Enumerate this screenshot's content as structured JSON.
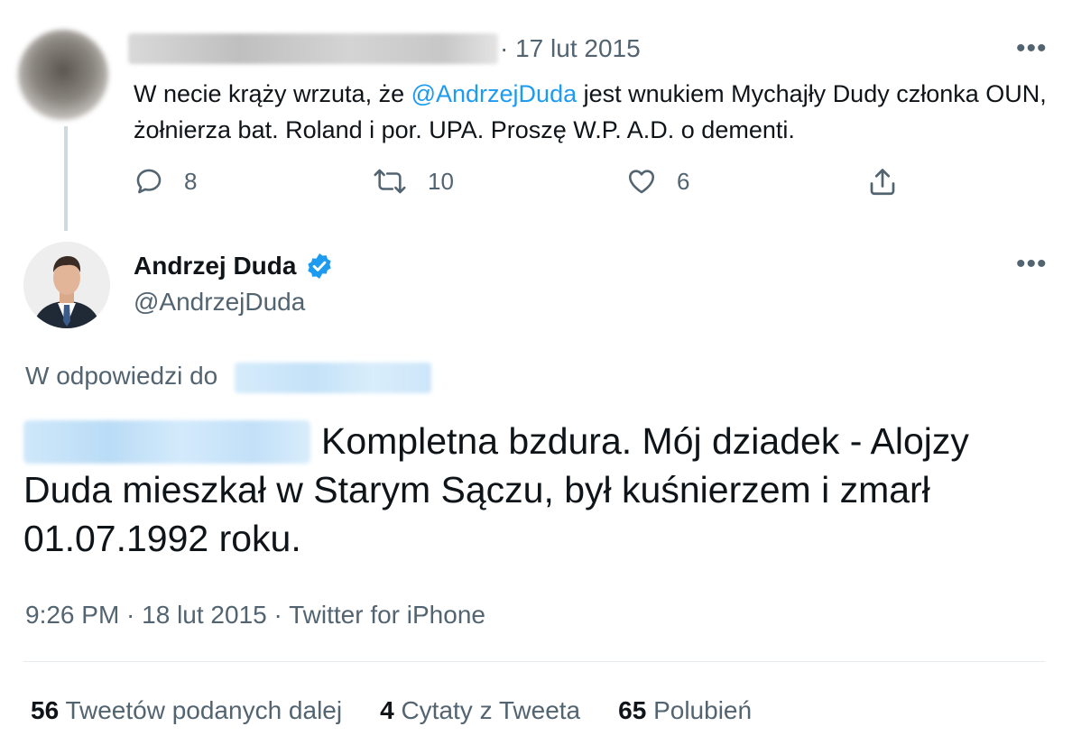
{
  "parent_tweet": {
    "date": "· 17 lut 2015",
    "text_before": "W necie krąży wrzuta, że ",
    "mention": "@AndrzejDuda",
    "text_after": " jest wnukiem Mychajły Dudy członka OUN, żołnierza bat. Roland i por. UPA. Proszę W.P. A.D. o dementi.",
    "replies": "8",
    "retweets": "10",
    "likes": "6",
    "more": "•••"
  },
  "main_tweet": {
    "name": "Andrzej Duda",
    "handle": "@AndrzejDuda",
    "more": "•••",
    "reply_to_label": "W odpowiedzi do",
    "text": "Kompletna bzdura. Mój dziadek - Alojzy Duda mieszkał w Starym Sączu, był kuśnierzem i zmarł 01.07.1992 roku.",
    "timestamp": "9:26 PM · 18 lut 2015 · Twitter for iPhone",
    "stats": [
      {
        "count": "56",
        "label": "Tweetów podanych dalej"
      },
      {
        "count": "4",
        "label": "Cytaty z Tweeta"
      },
      {
        "count": "65",
        "label": "Polubień"
      }
    ]
  },
  "colors": {
    "accent": "#1d9bf0",
    "secondary_text": "#536471",
    "primary_text": "#0f1419"
  },
  "icons": [
    "reply-icon",
    "retweet-icon",
    "like-icon",
    "share-icon",
    "verified-badge-icon",
    "more-icon"
  ]
}
